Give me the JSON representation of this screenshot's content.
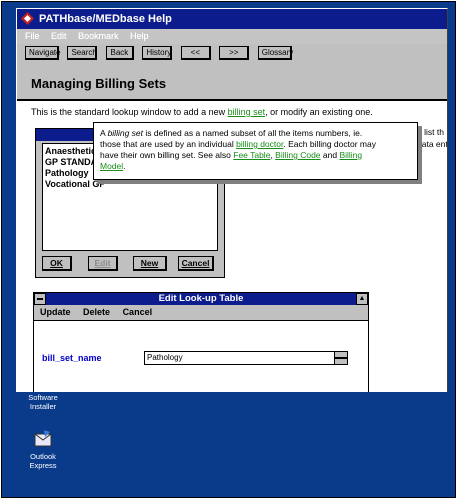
{
  "window": {
    "title": "PATHbase/MEDbase Help",
    "menu": [
      "File",
      "Edit",
      "Bookmark",
      "Help"
    ],
    "toolbar": [
      "Navigate",
      "Search",
      "Back",
      "History",
      "<<",
      ">>",
      "Glossary"
    ]
  },
  "topic": {
    "heading": "Managing Billing Sets",
    "intro_before": "This is the standard lookup window to add a new ",
    "intro_link": "billing set",
    "intro_after": ", or modify an existing one.",
    "side_line1": "e list th",
    "side_line2": "data ent"
  },
  "lookup": {
    "items": [
      "Anaesthetic",
      "GP STANDA",
      "Pathology",
      "Vocational GP"
    ],
    "buttons": {
      "ok": "OK",
      "edit": "Edit",
      "new": "New",
      "cancel": "Cancel"
    }
  },
  "popup": {
    "t1": "A ",
    "t2": "billing set",
    "t3": " is defined as a named subset of all the items numbers, ie.",
    "t4": "those that are used by an individual ",
    "t5": "billing doctor",
    "t6": ". Each billing doctor may",
    "t7": "have their own billing set. See also ",
    "t8": "Fee Table",
    "t9": ", ",
    "t10": "Billing Code",
    "t11": " and ",
    "t12": "Billing",
    "t13": "Model",
    "t14": "."
  },
  "edit": {
    "title": "Edit Look-up Table",
    "menu": [
      "Update",
      "Delete",
      "Cancel"
    ],
    "field_label": "bill_set_name",
    "field_value": "Pathology"
  },
  "desktop": {
    "icon1_line1": "Software",
    "icon1_line2": "Installer",
    "icon2_line1": "Outlook",
    "icon2_line2": "Express"
  },
  "colors": {
    "titlebar": "#0c1c8c",
    "desktop": "#0a3a8a",
    "link": "#1a8c1a"
  }
}
